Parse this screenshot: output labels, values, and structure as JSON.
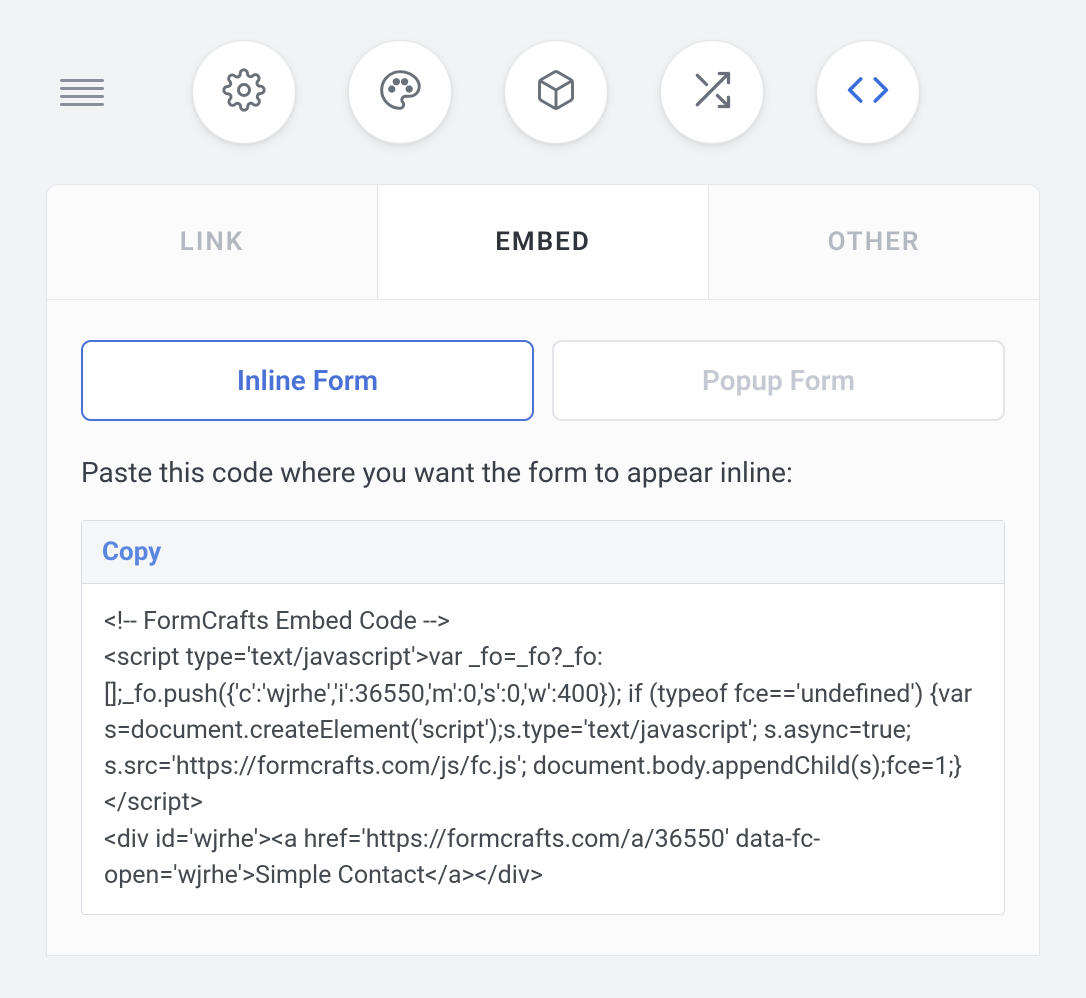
{
  "toolbar": {
    "icons": [
      "gear-icon",
      "palette-icon",
      "cube-icon",
      "shuffle-icon",
      "code-icon"
    ],
    "active": "code-icon"
  },
  "tabs": {
    "link": "LINK",
    "embed": "EMBED",
    "other": "OTHER",
    "active": "embed"
  },
  "embed": {
    "formTypeToggle": {
      "inline": "Inline Form",
      "popup": "Popup Form",
      "active": "inline"
    },
    "instruction": "Paste this code where you want the form to appear inline:",
    "copyLabel": "Copy",
    "code": "<!-- FormCrafts Embed Code -->\n<script type='text/javascript'>var _fo=_fo?_fo:[];_fo.push({'c':'wjrhe','i':36550,'m':0,'s':0,'w':400}); if (typeof fce=='undefined') {var s=document.createElement('script');s.type='text/javascript'; s.async=true; s.src='https://formcrafts.com/js/fc.js'; document.body.appendChild(s);fce=1;}</script>\n<div id='wjrhe'><a href='https://formcrafts.com/a/36550' data-fc-open='wjrhe'>Simple Contact</a></div>"
  }
}
